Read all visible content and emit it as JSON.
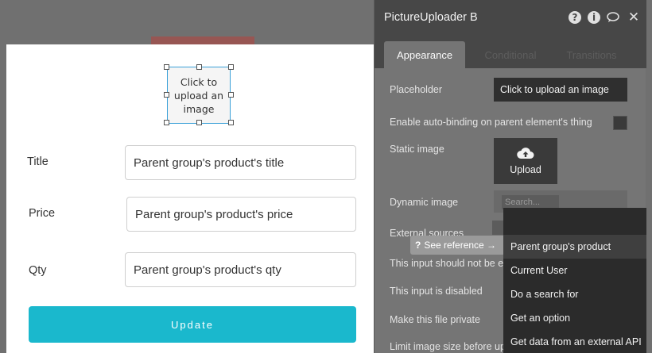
{
  "uploader": {
    "text": "Click to upload an image"
  },
  "form": {
    "fields": [
      {
        "label": "Title",
        "value": "Parent group's product's title"
      },
      {
        "label": "Price",
        "value": "Parent group's product's price"
      },
      {
        "label": "Qty",
        "value": "Parent group's product's qty"
      }
    ],
    "button_label": "Update"
  },
  "panel": {
    "title": "PictureUploader B",
    "tabs": [
      {
        "label": "Appearance",
        "active": true
      },
      {
        "label": "Conditional",
        "active": false
      },
      {
        "label": "Transitions",
        "active": false
      }
    ],
    "properties": {
      "placeholder_label": "Placeholder",
      "placeholder_value": "Click to upload an image",
      "auto_binding_label": "Enable auto-binding on parent element's thing",
      "static_image_label": "Static image",
      "upload_label": "Upload",
      "dynamic_image_label": "Dynamic image",
      "search_placeholder": "Search...",
      "external_sources_label": "External sources",
      "not_empty_label": "This input should not be e",
      "disabled_label": "This input is disabled",
      "private_label": "Make this file private",
      "limit_size_label": "Limit image size before up"
    }
  },
  "see_reference": {
    "label": "See reference →",
    "icon": "?"
  },
  "dropdown": {
    "items": [
      {
        "label": "Parent group's product",
        "selected": true
      },
      {
        "label": "Current User",
        "selected": false
      },
      {
        "label": "Do a search for",
        "selected": false
      },
      {
        "label": "Get an option",
        "selected": false
      },
      {
        "label": "Get data from an external API",
        "selected": false
      }
    ]
  },
  "colors": {
    "accent": "#1ab8cd",
    "panel_header": "#474747",
    "panel_body": "#757575"
  }
}
